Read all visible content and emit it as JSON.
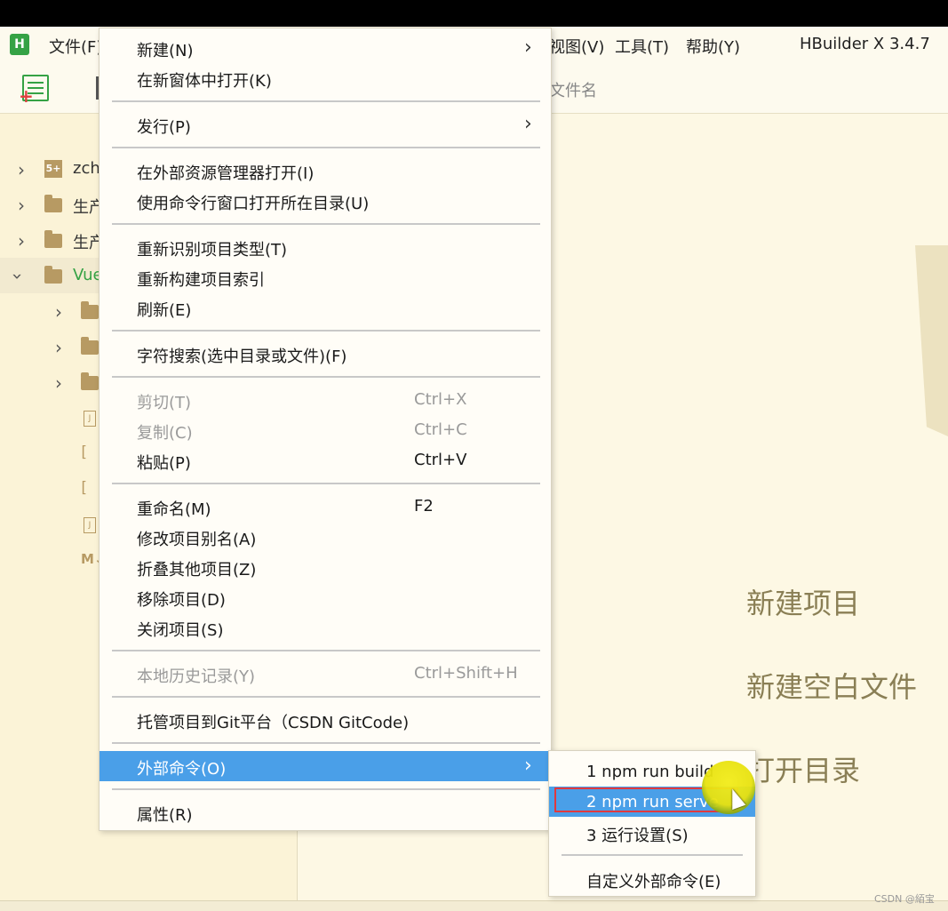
{
  "menubar": {
    "logo": "H",
    "file": "文件(F)",
    "view": "视图(V)",
    "tools": "工具(T)",
    "help": "帮助(Y)",
    "version": "HBuilder X 3.4.7"
  },
  "toolbar": {
    "search_hint": "文件名"
  },
  "sidebar": {
    "items": [
      {
        "label": "zch"
      },
      {
        "label": "生产"
      },
      {
        "label": "生产"
      },
      {
        "label": "Vue"
      }
    ]
  },
  "context_menu": {
    "new": {
      "label": "新建(N)"
    },
    "open_new_window": {
      "label": "在新窗体中打开(K)"
    },
    "publish": {
      "label": "发行(P)"
    },
    "open_explorer": {
      "label": "在外部资源管理器打开(I)"
    },
    "open_cmd": {
      "label": "使用命令行窗口打开所在目录(U)"
    },
    "reidentify": {
      "label": "重新识别项目类型(T)"
    },
    "rebuild_index": {
      "label": "重新构建项目索引"
    },
    "refresh": {
      "label": "刷新(E)"
    },
    "search": {
      "label": "字符搜索(选中目录或文件)(F)"
    },
    "cut": {
      "label": "剪切(T)",
      "shortcut": "Ctrl+X"
    },
    "copy": {
      "label": "复制(C)",
      "shortcut": "Ctrl+C"
    },
    "paste": {
      "label": "粘贴(P)",
      "shortcut": "Ctrl+V"
    },
    "rename": {
      "label": "重命名(M)",
      "shortcut": "F2"
    },
    "alias": {
      "label": "修改项目别名(A)"
    },
    "fold_others": {
      "label": "折叠其他项目(Z)"
    },
    "remove": {
      "label": "移除项目(D)"
    },
    "close": {
      "label": "关闭项目(S)"
    },
    "history": {
      "label": "本地历史记录(Y)",
      "shortcut": "Ctrl+Shift+H"
    },
    "git": {
      "label": "托管项目到Git平台（CSDN GitCode)"
    },
    "external": {
      "label": "外部命令(O)"
    },
    "properties": {
      "label": "属性(R)"
    }
  },
  "submenu": {
    "items": [
      {
        "label": "1 npm run build"
      },
      {
        "label": "2 npm run serve"
      },
      {
        "label": "3 运行设置(S)"
      },
      {
        "label": "自定义外部命令(E)"
      }
    ]
  },
  "welcome": {
    "new_project": "新建项目",
    "new_blank_file": "新建空白文件",
    "open_dir": "打开目录"
  },
  "watermark": "CSDN @絔宝",
  "colors": {
    "accent": "#4a9fe8",
    "brand_green": "#35a245",
    "background": "#fdf8e4",
    "highlight_box": "#e0393e"
  }
}
